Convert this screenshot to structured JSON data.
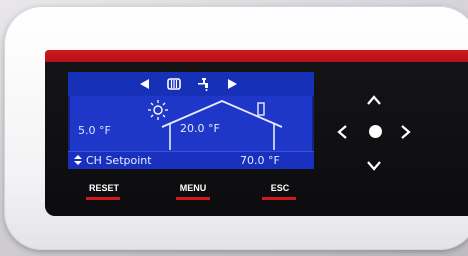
{
  "lcd": {
    "nav_left_icon": "triangle-left-icon",
    "nav_mode_icon": "radiator-icon",
    "nav_tap_icon": "tap-icon",
    "nav_right_icon": "triangle-right-icon",
    "outside_temp": "5.0 °F",
    "inside_temp": "20.0 °F",
    "bottom_label": "CH Setpoint",
    "bottom_value": "70.0 °F"
  },
  "buttons": {
    "reset": "RESET",
    "menu": "MENU",
    "esc": "ESC"
  },
  "dpad": {
    "up_icon": "chevron-up-icon",
    "down_icon": "chevron-down-icon",
    "left_icon": "chevron-left-icon",
    "right_icon": "chevron-right-icon",
    "center_icon": "ok-dot-icon"
  },
  "colors": {
    "accent_red": "#d11a1f",
    "lcd_blue": "#1f37c8",
    "panel_black": "#111113"
  }
}
